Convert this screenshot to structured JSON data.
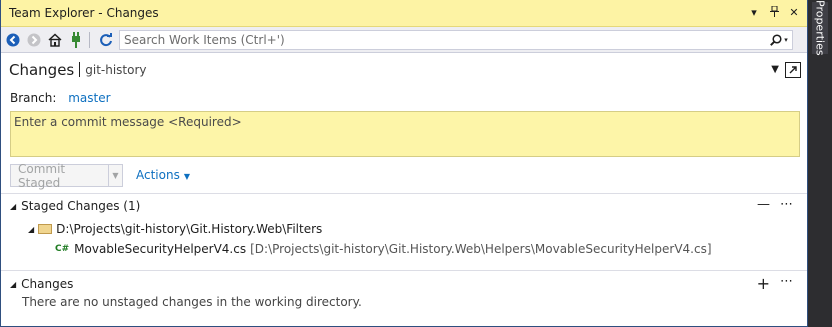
{
  "window": {
    "title": "Team Explorer - Changes"
  },
  "toolbar": {
    "search_placeholder": "Search Work Items (Ctrl+')"
  },
  "header": {
    "page_title": "Changes",
    "repo_name": "git-history"
  },
  "branch": {
    "label": "Branch:",
    "name": "master"
  },
  "commit": {
    "placeholder": "Enter a commit message <Required>",
    "button_label": "Commit Staged"
  },
  "actions_label": "Actions",
  "staged": {
    "heading": "Staged Changes (1)",
    "folder_path": "D:\\Projects\\git-history\\Git.History.Web\\Filters",
    "file_name": "MovableSecurityHelperV4.cs",
    "file_path": "[D:\\Projects\\git-history\\Git.History.Web\\Helpers\\MovableSecurityHelperV4.cs]",
    "file_icon_text": "C#"
  },
  "changes": {
    "heading": "Changes",
    "empty_message": "There are no unstaged changes in the working directory."
  },
  "properties_tab": "Properties",
  "colors": {
    "title_bar": "#fdf3a4",
    "commit_box": "#fdf5a8",
    "link": "#0e70c0",
    "chrome": "#2d2d30"
  }
}
